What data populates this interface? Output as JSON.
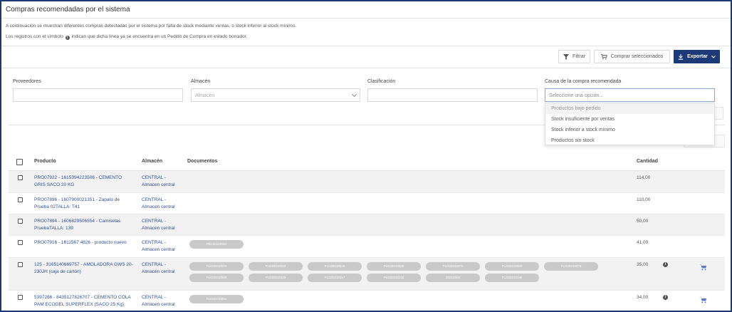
{
  "panel": {
    "title": "Compras recomendadas por el sistema"
  },
  "intro": {
    "line1": "A continuación se muestran diferentes compras detectadas por el sistema por falta de stock mediante ventas, o stock inferior al stock mínimo.",
    "line2_before": "Los registros con el símbolo",
    "line2_after": "indican que dicha línea ya se encuentra en un Pedido de Compra en estado borrador."
  },
  "toolbar": {
    "filter_label": "Filtrar",
    "buy_selected_label": "Comprar seleccionados",
    "export_label": "Exportar"
  },
  "filters": {
    "proveedores": {
      "label": "Proveedores",
      "value": ""
    },
    "almacen": {
      "label": "Almacén",
      "placeholder": "Almacén"
    },
    "clasificacion": {
      "label": "Clasificación",
      "value": ""
    },
    "causa": {
      "label": "Causa de la compra recomendada",
      "placeholder": "Seleccione una opción...",
      "options": [
        "Productos bajo pedido",
        "Stock insuficiente por ventas",
        "Stock inferior a stock mínimo",
        "Productos sin stock"
      ]
    }
  },
  "table": {
    "headers": {
      "producto": "Producto",
      "almacen": "Almacén",
      "documentos": "Documentos",
      "cantidad": "Cantidad"
    },
    "rows": [
      {
        "producto": "PRO07922 - 1615394223506 - CEMENTO GRIS SACO 20 KG",
        "almacen": "CENTRAL - Almacen central",
        "documentos": [],
        "cantidad": "114,00",
        "has_info": false,
        "has_cart": false
      },
      {
        "producto": "PRO07896 - 1607900021351 - Zapato de Prueba 02TALLA: T41",
        "almacen": "CENTRAL - Almacen central",
        "documentos": [],
        "cantidad": "110,00",
        "has_info": false,
        "has_cart": false
      },
      {
        "producto": "PRO07894 - 1606829506554 - Camisetas PruebaTALLA: 139",
        "almacen": "CENTRAL - Almacen central",
        "documentos": [],
        "cantidad": "50,00",
        "has_info": false,
        "has_cart": false
      },
      {
        "producto": "PRO07916 - 1611567 4826 - producto nuevo",
        "almacen": "CENTRAL - Almacen central",
        "documentos": [
          "PED20210902"
        ],
        "cantidad": "41,00",
        "has_info": false,
        "has_cart": false
      },
      {
        "producto": "125 - 3165140669757 - AMOLADORA GWS 20-230JH (caja de cartón)",
        "almacen": "CENTRAL - Almacen central",
        "documentos": [
          "PLD20210074",
          "PLD20210022",
          "PLD20210026",
          "PLD20210038",
          "PLD20210076",
          "PLD20210050",
          "PLD20210079",
          "PLD20210068",
          "PLD20210115",
          "PLD20210117",
          "PLD20210118",
          "20210004",
          "PLD20210146"
        ],
        "cantidad": "35,00",
        "has_info": true,
        "has_cart": true
      },
      {
        "producto": "5397266 - 8435127826707 - CEMENTO COLA PAM ECOGEL SUPERFLEX (SACO 25 Kg)",
        "almacen": "CENTRAL - Almacen central",
        "documentos": [
          "PLD20210094"
        ],
        "cantidad": "34,00",
        "has_info": true,
        "has_cart": true
      }
    ]
  },
  "colors": {
    "accent": "#1d3a78",
    "link": "#2d4fa0",
    "pill": "#c9c9c9"
  }
}
